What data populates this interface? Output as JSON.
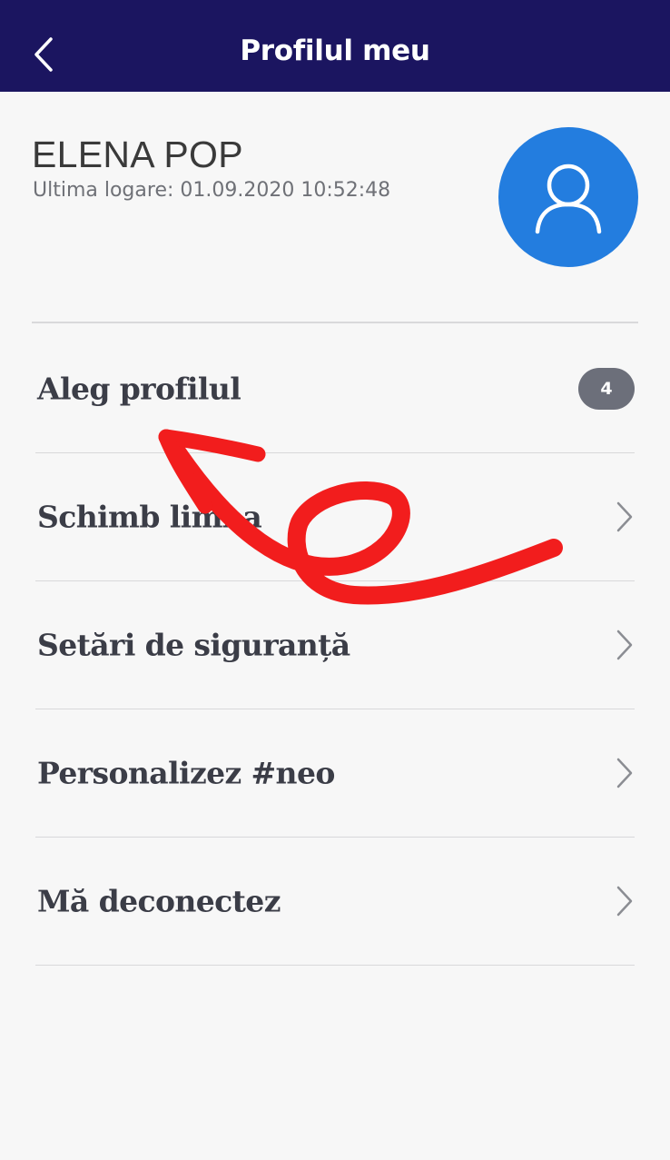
{
  "header": {
    "title": "Profilul meu"
  },
  "profile": {
    "name": "ELENA POP",
    "last_login": "Ultima logare: 01.09.2020 10:52:48"
  },
  "menu": {
    "items": [
      {
        "label": "Aleg profilul",
        "badge": "4"
      },
      {
        "label": "Schimb limba"
      },
      {
        "label": "Setări de siguranță"
      },
      {
        "label": "Personalizez #neo"
      },
      {
        "label": "Mă deconectez"
      }
    ]
  },
  "colors": {
    "header_bg": "#1b1560",
    "avatar_bg": "#237ddf",
    "badge_bg": "#6c6f7a",
    "annotation": "#f21d1d",
    "page_bg": "#f7f7f7"
  },
  "icons": {
    "back": "chevron-left-icon",
    "avatar": "user-icon",
    "row_arrow": "chevron-right-icon"
  }
}
